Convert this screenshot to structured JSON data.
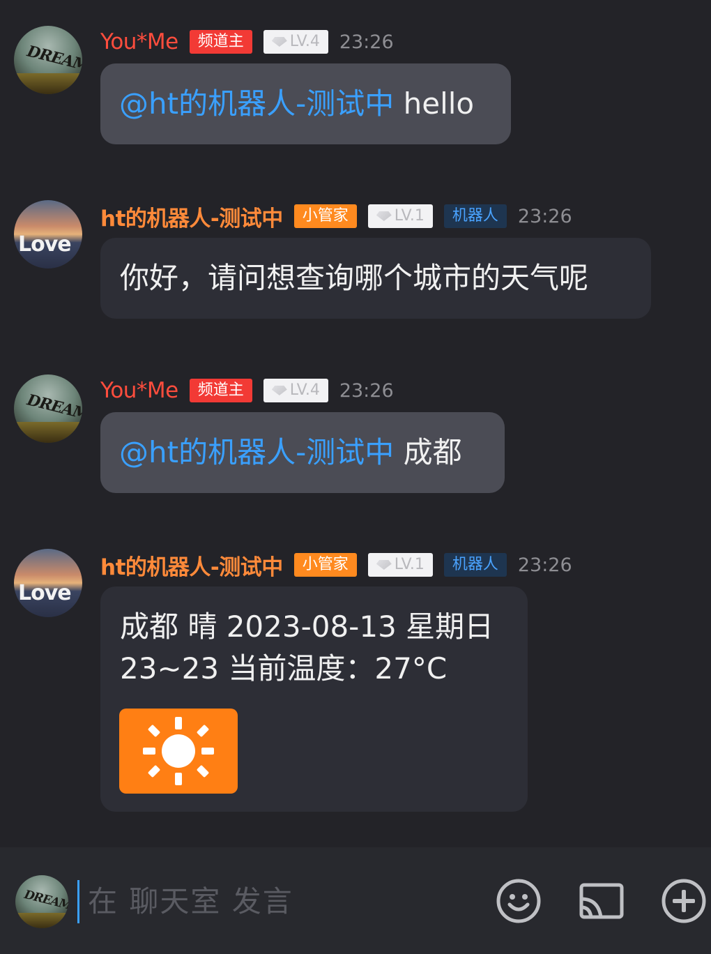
{
  "messages": [
    {
      "author": "You*Me",
      "role_badge": "频道主",
      "level": "LV.4",
      "time": "23:26",
      "mention": "@ht的机器人-测试中",
      "text": "hello",
      "avatar_text": "DREAM"
    },
    {
      "author": "ht的机器人-测试中",
      "role_badge": "小管家",
      "level": "LV.1",
      "bot_badge": "机器人",
      "time": "23:26",
      "text": "你好，请问想查询哪个城市的天气呢",
      "avatar_text": "Love"
    },
    {
      "author": "You*Me",
      "role_badge": "频道主",
      "level": "LV.4",
      "time": "23:26",
      "mention": "@ht的机器人-测试中",
      "text": "成都",
      "avatar_text": "DREAM"
    },
    {
      "author": "ht的机器人-测试中",
      "role_badge": "小管家",
      "level": "LV.1",
      "bot_badge": "机器人",
      "time": "23:26",
      "text_line1": "成都 晴 2023-08-13 星期日",
      "text_line2": "23~23 当前温度：27°C",
      "weather_icon": "sun-icon",
      "avatar_text": "Love"
    }
  ],
  "input": {
    "placeholder": "在 聊天室 发言",
    "avatar_text": "DREAM",
    "icons": [
      "emoji-icon",
      "screen-share-icon",
      "plus-icon"
    ]
  },
  "colors": {
    "background": "#232328",
    "mention": "#3aa0ff",
    "owner_badge": "#f23a35",
    "admin_badge": "#ff8a1f",
    "weather_card": "#ff7f14"
  }
}
